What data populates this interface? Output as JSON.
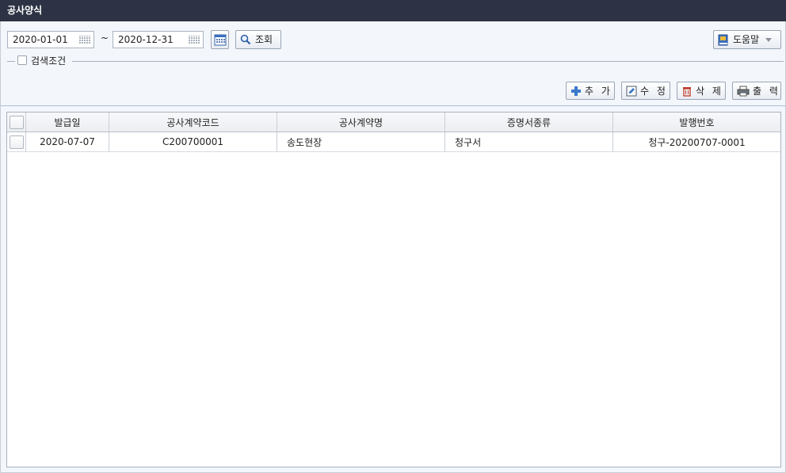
{
  "window": {
    "title": "공사양식"
  },
  "filters": {
    "date_from": "2020-01-01",
    "date_to": "2020-12-31",
    "range_separator": "~",
    "search_label": "조회",
    "help_label": "도움말",
    "condition_label": "검색조건"
  },
  "actions": {
    "add_label": "추 가",
    "edit_label": "수 정",
    "delete_label": "삭 제",
    "print_label": "출 력"
  },
  "table": {
    "columns": [
      "발급일",
      "공사계약코드",
      "공사계약명",
      "증명서종류",
      "발행번호"
    ],
    "rows": [
      [
        "2020-07-07",
        "C200700001",
        "송도현장",
        "청구서",
        "청구-20200707-0001"
      ]
    ]
  },
  "colors": {
    "titlebar_bg": "#2d3344",
    "panel_bg": "#f3f6fb",
    "add_icon": "#3a78c9",
    "delete_icon": "#c0392b"
  }
}
